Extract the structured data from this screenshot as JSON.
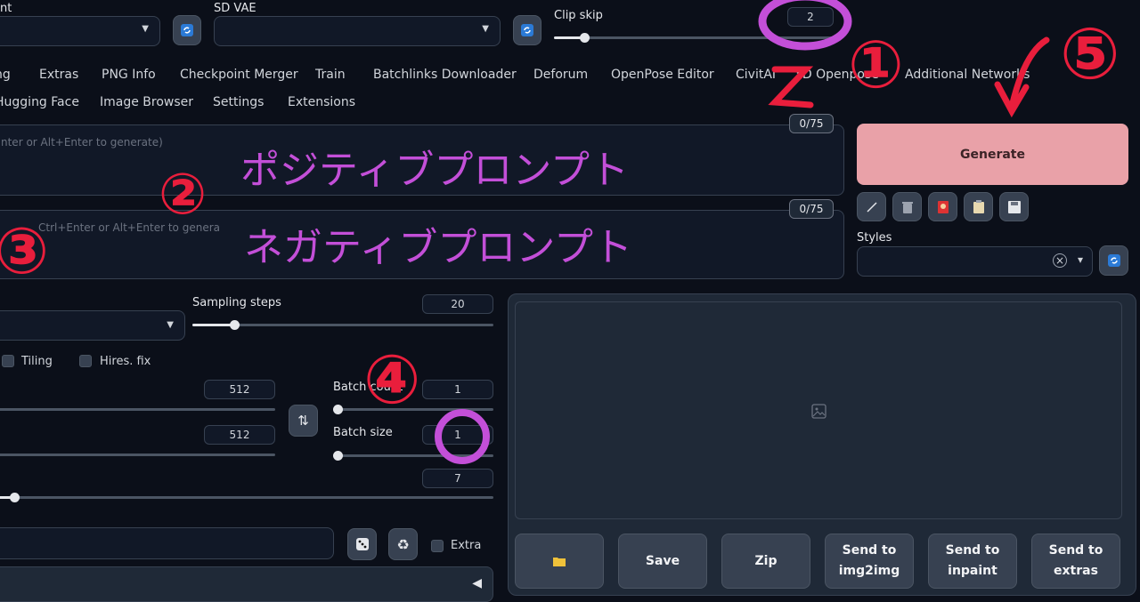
{
  "top": {
    "checkpoint_label": "nt",
    "sd_vae_label": "SD VAE",
    "clip_skip_label": "Clip skip",
    "clip_skip_value": "2",
    "clip_skip_level": 0.1
  },
  "tabs_row1": [
    "ng",
    "Extras",
    "PNG Info",
    "Checkpoint Merger",
    "Train",
    "Batchlinks Downloader",
    "Deforum",
    "OpenPose Editor",
    "CivitAI",
    "3D Openpose",
    "Additional Networks"
  ],
  "tabs_row2": [
    "Hugging Face",
    "Image Browser",
    "Settings",
    "Extensions"
  ],
  "prompts": {
    "positive_placeholder": "nter or Alt+Enter to generate)",
    "negative_placeholder": "Ctrl+Enter or Alt+Enter to genera",
    "positive_counter": "0/75",
    "negative_counter": "0/75"
  },
  "generate": {
    "label": "Generate",
    "color": "#e9a1a8"
  },
  "styles": {
    "label": "Styles",
    "clear": "×",
    "dropdown": "▾"
  },
  "params": {
    "sampling_steps_label": "Sampling steps",
    "sampling_steps_value": "20",
    "tiling_label": "Tiling",
    "hires_label": "Hires. fix",
    "width_value": "512",
    "height_value": "512",
    "batch_count_label": "Batch count",
    "batch_count_value": "1",
    "batch_size_label": "Batch size",
    "batch_size_value": "1",
    "cfg_value": "7",
    "extra_label": "Extra",
    "swap_icon": "⇅"
  },
  "output_buttons": [
    {
      "label": "",
      "icon": "folder-icon"
    },
    {
      "label": "Save"
    },
    {
      "label": "Zip"
    },
    {
      "label": "Send to\nimg2img"
    },
    {
      "label": "Send to\ninpaint"
    },
    {
      "label": "Send to\nextras"
    }
  ],
  "annotations": {
    "positive_prompt_jp": "ポジティブプロンプト",
    "negative_prompt_jp": "ネガティブプロンプト",
    "mark1": "①",
    "mark2": "②",
    "mark3": "③",
    "mark4": "④",
    "mark5": "⑤"
  },
  "colors": {
    "background": "#0b0f19",
    "accent_purple": "#c34fd8",
    "annotation_red": "#e91e3c"
  }
}
